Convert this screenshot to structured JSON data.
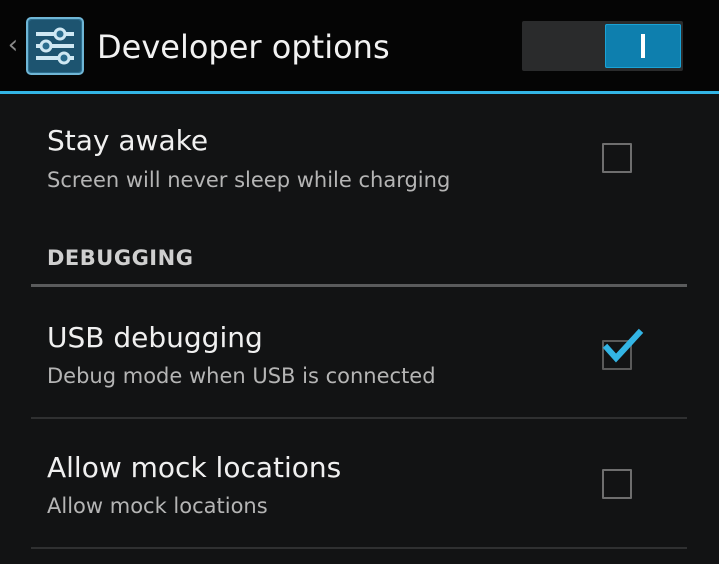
{
  "action_bar": {
    "title": "Developer options",
    "up_icon": "chevron-left-icon",
    "app_icon": "settings-sliders-icon",
    "master_switch": {
      "on": true,
      "accent": "#0e7fae"
    }
  },
  "accent_color": "#33b5e5",
  "preferences": [
    {
      "title": "Stay awake",
      "summary": "Screen will never sleep while charging",
      "checked": false
    },
    {
      "title": "USB debugging",
      "summary": "Debug mode when USB is connected",
      "checked": true
    },
    {
      "title": "Allow mock locations",
      "summary": "Allow mock locations",
      "checked": false
    }
  ],
  "categories": {
    "debugging": "DEBUGGING"
  }
}
